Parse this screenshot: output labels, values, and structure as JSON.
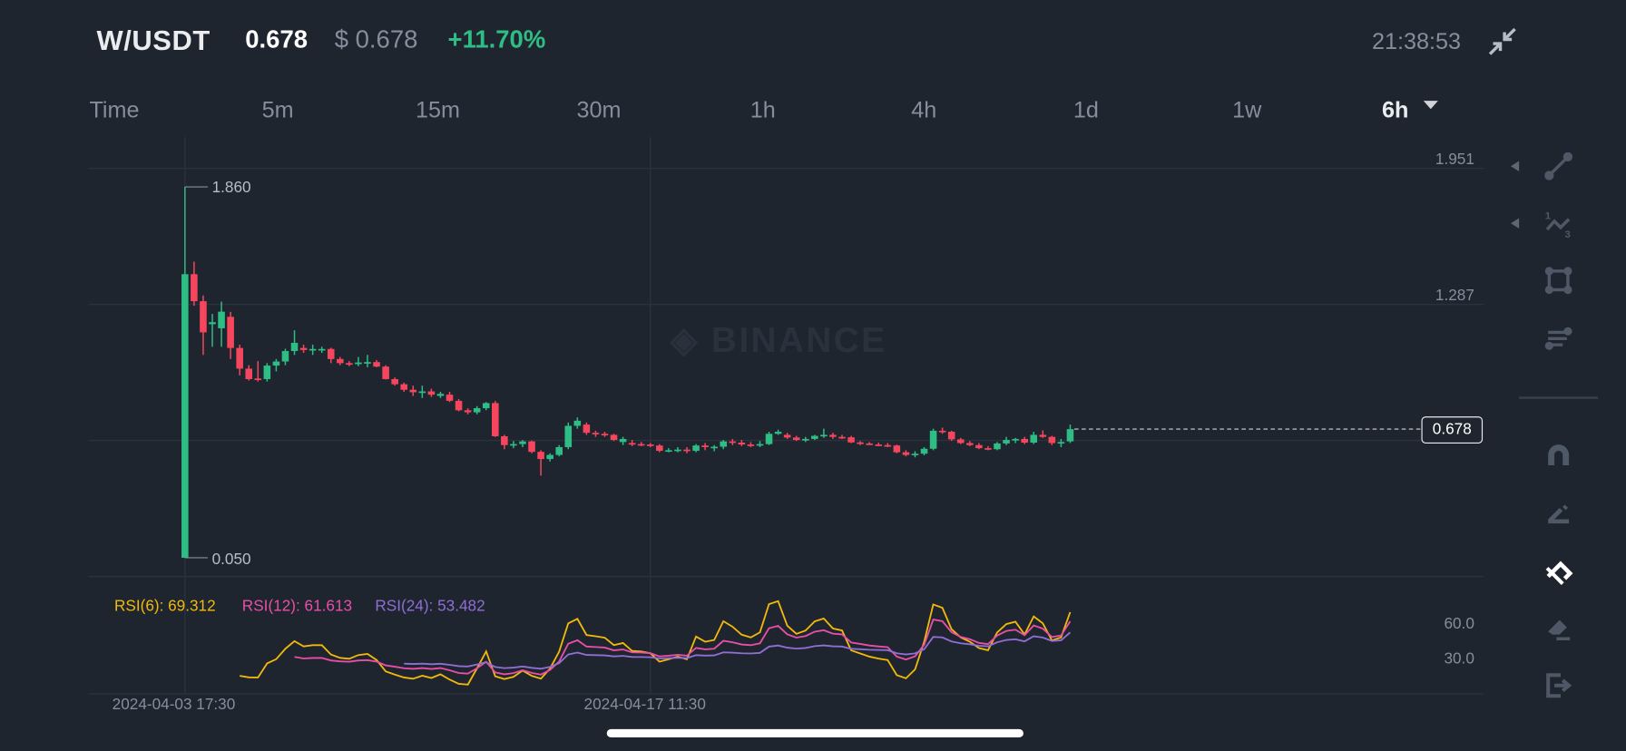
{
  "header": {
    "pair": "W/USDT",
    "last_price": "0.678",
    "usd_price": "$ 0.678",
    "change": "+11.70%",
    "clock": "21:38:53",
    "collapse_icon": "collapse-arrows-icon"
  },
  "intervals": [
    {
      "label": "Time"
    },
    {
      "label": "5m"
    },
    {
      "label": "15m"
    },
    {
      "label": "30m"
    },
    {
      "label": "1h"
    },
    {
      "label": "4h"
    },
    {
      "label": "1d"
    },
    {
      "label": "1w"
    },
    {
      "label": "6h",
      "active": true
    }
  ],
  "watermark": "BINANCE",
  "toolbar": [
    "trend-line-icon",
    "wave-pattern-icon",
    "rectangle-icon",
    "fib-levels-icon",
    "magnet-icon",
    "pencil-lock-icon",
    "hide-drawings-icon",
    "eraser-icon",
    "exit-icon"
  ],
  "colors": {
    "up": "#2ebd85",
    "down": "#f6465d",
    "rsi6": "#f0b90b",
    "rsi12": "#e84fa8",
    "rsi24": "#8f6ed5",
    "bg": "#1f252f"
  },
  "chart_data": {
    "type": "candlestick",
    "title": "W/USDT 6h",
    "price_axis_ticks": [
      "1.951",
      "1.287"
    ],
    "price_gridlines": [
      1.951,
      1.287,
      0.623
    ],
    "high_marker": "1.860",
    "low_marker": "0.050",
    "current_price_tag": "0.678",
    "x_tick_labels": [
      "2024-04-03 17:30",
      "2024-04-17 11:30"
    ],
    "x_tick_candle_index": [
      0,
      51
    ],
    "ohlc": [
      [
        0.05,
        1.86,
        0.05,
        1.434
      ],
      [
        1.434,
        1.495,
        1.28,
        1.302
      ],
      [
        1.302,
        1.33,
        1.04,
        1.15
      ],
      [
        1.19,
        1.24,
        1.08,
        1.2
      ],
      [
        1.17,
        1.3,
        1.08,
        1.251
      ],
      [
        1.226,
        1.25,
        1.02,
        1.074
      ],
      [
        1.074,
        1.09,
        0.94,
        0.973
      ],
      [
        0.973,
        0.99,
        0.915,
        0.922
      ],
      [
        0.925,
        1.01,
        0.91,
        0.92
      ],
      [
        0.922,
        1.0,
        0.91,
        0.988
      ],
      [
        0.988,
        1.02,
        0.96,
        1.008
      ],
      [
        1.008,
        1.07,
        0.99,
        1.059
      ],
      [
        1.059,
        1.16,
        1.04,
        1.099
      ],
      [
        1.074,
        1.09,
        1.05,
        1.064
      ],
      [
        1.064,
        1.09,
        1.04,
        1.069
      ],
      [
        1.064,
        1.08,
        1.05,
        1.069
      ],
      [
        1.069,
        1.075,
        1.0,
        1.02
      ],
      [
        1.02,
        1.03,
        0.99,
        1.0
      ],
      [
        1.0,
        1.01,
        0.985,
        0.995
      ],
      [
        0.995,
        1.03,
        0.985,
        1.003
      ],
      [
        1.0,
        1.04,
        0.98,
        1.005
      ],
      [
        1.005,
        1.015,
        0.98,
        0.983
      ],
      [
        0.983,
        0.99,
        0.92,
        0.922
      ],
      [
        0.922,
        0.93,
        0.89,
        0.897
      ],
      [
        0.897,
        0.905,
        0.86,
        0.87
      ],
      [
        0.87,
        0.89,
        0.84,
        0.858
      ],
      [
        0.858,
        0.89,
        0.83,
        0.862
      ],
      [
        0.862,
        0.875,
        0.835,
        0.846
      ],
      [
        0.84,
        0.86,
        0.83,
        0.85
      ],
      [
        0.846,
        0.86,
        0.81,
        0.816
      ],
      [
        0.816,
        0.825,
        0.765,
        0.77
      ],
      [
        0.77,
        0.78,
        0.75,
        0.76
      ],
      [
        0.76,
        0.79,
        0.75,
        0.78
      ],
      [
        0.78,
        0.81,
        0.77,
        0.805
      ],
      [
        0.805,
        0.815,
        0.64,
        0.643
      ],
      [
        0.643,
        0.65,
        0.58,
        0.6
      ],
      [
        0.6,
        0.62,
        0.585,
        0.605
      ],
      [
        0.605,
        0.625,
        0.59,
        0.618
      ],
      [
        0.618,
        0.622,
        0.56,
        0.567
      ],
      [
        0.567,
        0.575,
        0.451,
        0.532
      ],
      [
        0.532,
        0.56,
        0.52,
        0.552
      ],
      [
        0.552,
        0.6,
        0.545,
        0.59
      ],
      [
        0.59,
        0.71,
        0.58,
        0.694
      ],
      [
        0.694,
        0.735,
        0.68,
        0.719
      ],
      [
        0.7,
        0.71,
        0.65,
        0.66
      ],
      [
        0.66,
        0.67,
        0.64,
        0.655
      ],
      [
        0.655,
        0.665,
        0.64,
        0.65
      ],
      [
        0.65,
        0.655,
        0.62,
        0.625
      ],
      [
        0.615,
        0.64,
        0.6,
        0.63
      ],
      [
        0.61,
        0.625,
        0.595,
        0.605
      ],
      [
        0.605,
        0.615,
        0.595,
        0.603
      ],
      [
        0.603,
        0.61,
        0.59,
        0.598
      ],
      [
        0.598,
        0.605,
        0.565,
        0.572
      ],
      [
        0.572,
        0.585,
        0.565,
        0.575
      ],
      [
        0.575,
        0.59,
        0.565,
        0.578
      ],
      [
        0.578,
        0.59,
        0.56,
        0.572
      ],
      [
        0.572,
        0.605,
        0.565,
        0.598
      ],
      [
        0.598,
        0.61,
        0.575,
        0.59
      ],
      [
        0.585,
        0.6,
        0.57,
        0.592
      ],
      [
        0.592,
        0.625,
        0.58,
        0.618
      ],
      [
        0.618,
        0.63,
        0.6,
        0.612
      ],
      [
        0.612,
        0.625,
        0.595,
        0.603
      ],
      [
        0.603,
        0.615,
        0.59,
        0.6
      ],
      [
        0.6,
        0.62,
        0.59,
        0.605
      ],
      [
        0.605,
        0.665,
        0.6,
        0.655
      ],
      [
        0.655,
        0.675,
        0.65,
        0.665
      ],
      [
        0.65,
        0.66,
        0.63,
        0.637
      ],
      [
        0.637,
        0.645,
        0.62,
        0.625
      ],
      [
        0.625,
        0.64,
        0.615,
        0.63
      ],
      [
        0.63,
        0.65,
        0.625,
        0.645
      ],
      [
        0.645,
        0.68,
        0.635,
        0.65
      ],
      [
        0.65,
        0.66,
        0.63,
        0.64
      ],
      [
        0.64,
        0.65,
        0.63,
        0.638
      ],
      [
        0.638,
        0.645,
        0.61,
        0.613
      ],
      [
        0.613,
        0.62,
        0.6,
        0.608
      ],
      [
        0.608,
        0.615,
        0.6,
        0.603
      ],
      [
        0.603,
        0.612,
        0.595,
        0.6
      ],
      [
        0.6,
        0.61,
        0.59,
        0.598
      ],
      [
        0.598,
        0.602,
        0.56,
        0.565
      ],
      [
        0.565,
        0.575,
        0.545,
        0.552
      ],
      [
        0.552,
        0.57,
        0.54,
        0.558
      ],
      [
        0.558,
        0.59,
        0.55,
        0.582
      ],
      [
        0.582,
        0.68,
        0.575,
        0.67
      ],
      [
        0.67,
        0.685,
        0.655,
        0.665
      ],
      [
        0.665,
        0.67,
        0.62,
        0.628
      ],
      [
        0.628,
        0.635,
        0.605,
        0.61
      ],
      [
        0.61,
        0.62,
        0.595,
        0.6
      ],
      [
        0.6,
        0.61,
        0.58,
        0.585
      ],
      [
        0.585,
        0.595,
        0.575,
        0.58
      ],
      [
        0.58,
        0.615,
        0.575,
        0.608
      ],
      [
        0.608,
        0.64,
        0.6,
        0.625
      ],
      [
        0.625,
        0.635,
        0.61,
        0.63
      ],
      [
        0.63,
        0.64,
        0.605,
        0.612
      ],
      [
        0.612,
        0.665,
        0.605,
        0.65
      ],
      [
        0.65,
        0.672,
        0.635,
        0.64
      ],
      [
        0.64,
        0.645,
        0.6,
        0.61
      ],
      [
        0.61,
        0.63,
        0.59,
        0.615
      ],
      [
        0.618,
        0.7,
        0.61,
        0.678
      ]
    ],
    "rsi": {
      "legend": [
        {
          "label": "RSI(6): 69.312",
          "period": 6
        },
        {
          "label": "RSI(12): 61.613",
          "period": 12
        },
        {
          "label": "RSI(24): 53.482",
          "period": 24
        }
      ],
      "axis_ticks": [
        "60.0",
        "30.0"
      ]
    }
  }
}
